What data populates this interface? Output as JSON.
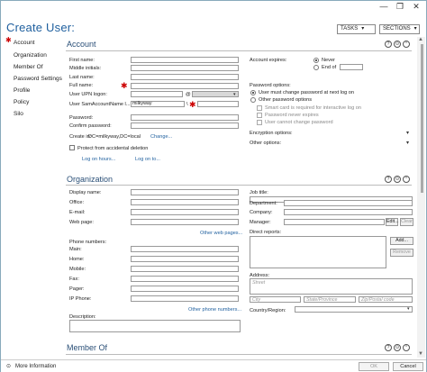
{
  "window": {
    "min": "—",
    "max": "❐",
    "close": "✕"
  },
  "header": {
    "title": "Create User:",
    "tasks_label": "TASKS",
    "sections_label": "SECTIONS",
    "chevron": "▾"
  },
  "sidebar": {
    "required_mark": "✱",
    "items": [
      "Account",
      "Organization",
      "Member Of",
      "Password Settings",
      "Profile",
      "Policy",
      "Silo"
    ]
  },
  "account": {
    "title": "Account",
    "help": "?",
    "collapse": "⊙",
    "toggle": "⌃",
    "labels": {
      "first_name": "First name:",
      "middle_initials": "Middle initials:",
      "last_name": "Last name:",
      "full_name": "Full name:",
      "upn": "User UPN logon:",
      "upn_at": "@",
      "sam": "User SamAccountName l...",
      "sam_prefix": "milkyway",
      "sam_sep": "\\",
      "password": "Password:",
      "confirm_password": "Confirm password:",
      "create_in": "Create in:",
      "create_in_value": "DC=milkyway,DC=local",
      "change_link": "Change...",
      "protect": "Protect from accidental deletion",
      "log_on_hours": "Log on hours...",
      "log_on_to": "Log on to...",
      "required": "✱"
    },
    "expires": {
      "label": "Account expires:",
      "never": "Never",
      "end_of": "End of"
    },
    "password_options": {
      "label": "Password options:",
      "must_change": "User must change password at next log on",
      "other": "Other password options",
      "smart_card": "Smart card is required for interactive log on",
      "never_expires": "Password never expires",
      "cannot_change": "User cannot change password"
    },
    "encryption": "Encryption options:",
    "other_options": "Other options:",
    "expand": "▾"
  },
  "organization": {
    "title": "Organization",
    "help": "?",
    "collapse": "⊙",
    "toggle": "⌃",
    "labels": {
      "display_name": "Display name:",
      "office": "Office:",
      "email": "E-mail:",
      "web_page": "Web page:",
      "other_web_pages": "Other web pages...",
      "phone_numbers": "Phone numbers:",
      "main": "Main:",
      "home": "Home:",
      "mobile": "Mobile:",
      "fax": "Fax:",
      "pager": "Pager:",
      "ip_phone": "IP Phone:",
      "other_phone_numbers": "Other phone numbers...",
      "description": "Description:",
      "job_title": "Job title:",
      "department": "Department:",
      "company": "Company:",
      "manager": "Manager:",
      "edit": "Edit...",
      "clear": "Clear",
      "direct_reports": "Direct reports:",
      "add": "Add...",
      "remove": "Remove",
      "address": "Address:",
      "street": "Street",
      "city": "City",
      "state": "State/Province",
      "zip": "Zip/Postal code",
      "country": "Country/Region:"
    }
  },
  "member_of": {
    "title": "Member Of",
    "help": "?",
    "collapse": "⊙",
    "toggle": "⌃"
  },
  "footer": {
    "toggle": "⊙",
    "more_info": "More Information",
    "ok": "OK",
    "cancel": "Cancel"
  }
}
